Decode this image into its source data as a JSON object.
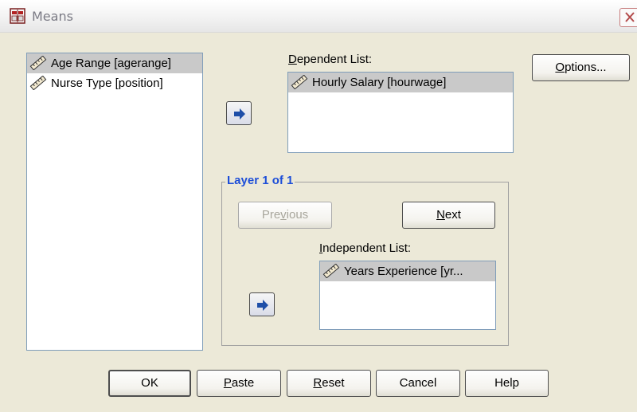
{
  "window": {
    "title": "Means"
  },
  "source_list": {
    "items": [
      {
        "label": "Age Range [agerange]",
        "selected": true
      },
      {
        "label": "Nurse Type [position]",
        "selected": false
      }
    ]
  },
  "dependent": {
    "label_mnemonic": "D",
    "label_rest": "ependent List:",
    "items": [
      {
        "label": "Hourly Salary [hourwage]",
        "selected": true
      }
    ]
  },
  "layer": {
    "title": "Layer 1 of 1",
    "previous_pre": "Pre",
    "previous_mnemonic": "v",
    "previous_post": "ious",
    "next_mnemonic": "N",
    "next_rest": "ext",
    "independent_label_mnemonic": "I",
    "independent_label_rest": "ndependent List:",
    "independent_items": [
      {
        "label": "Years Experience [yr...",
        "selected": true
      }
    ]
  },
  "buttons": {
    "options_mnemonic": "O",
    "options_rest": "ptions...",
    "ok": "OK",
    "paste_mnemonic": "P",
    "paste_rest": "aste",
    "reset_mnemonic": "R",
    "reset_rest": "eset",
    "cancel": "Cancel",
    "help": "Help"
  },
  "icons": {
    "variable": "ruler-icon",
    "move": "right-arrow-icon",
    "app": "spss-means-icon",
    "close": "close-icon"
  },
  "colors": {
    "dialog_bg": "#ece9d8",
    "selection": "#c9c9c9",
    "group_title": "#1d4ed8",
    "arrow": "#1f4fa8"
  }
}
